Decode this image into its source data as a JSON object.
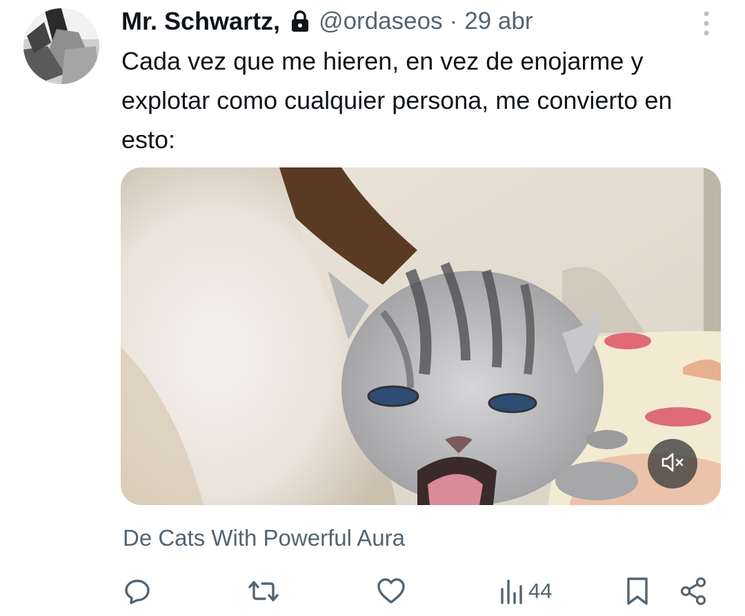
{
  "tweet": {
    "display_name": "Mr. Schwartz,",
    "handle": "@ordaseos",
    "separator": "·",
    "date": "29 abr",
    "text": "Cada vez que me hieren, en vez de enojarme y explotar como cualquier persona, me convierto en esto:",
    "source_attribution": "De Cats With Powerful Aura"
  },
  "icons": {
    "lock": "lock-icon",
    "more": "more-vertical-icon",
    "mute": "speaker-muted-icon",
    "reply": "reply-icon",
    "retweet": "retweet-icon",
    "like": "heart-icon",
    "views": "views-bar-icon",
    "bookmark": "bookmark-icon",
    "share": "share-icon"
  },
  "actions": {
    "views_count": "44"
  },
  "colors": {
    "text_primary": "#0f1419",
    "text_secondary": "#536471"
  }
}
